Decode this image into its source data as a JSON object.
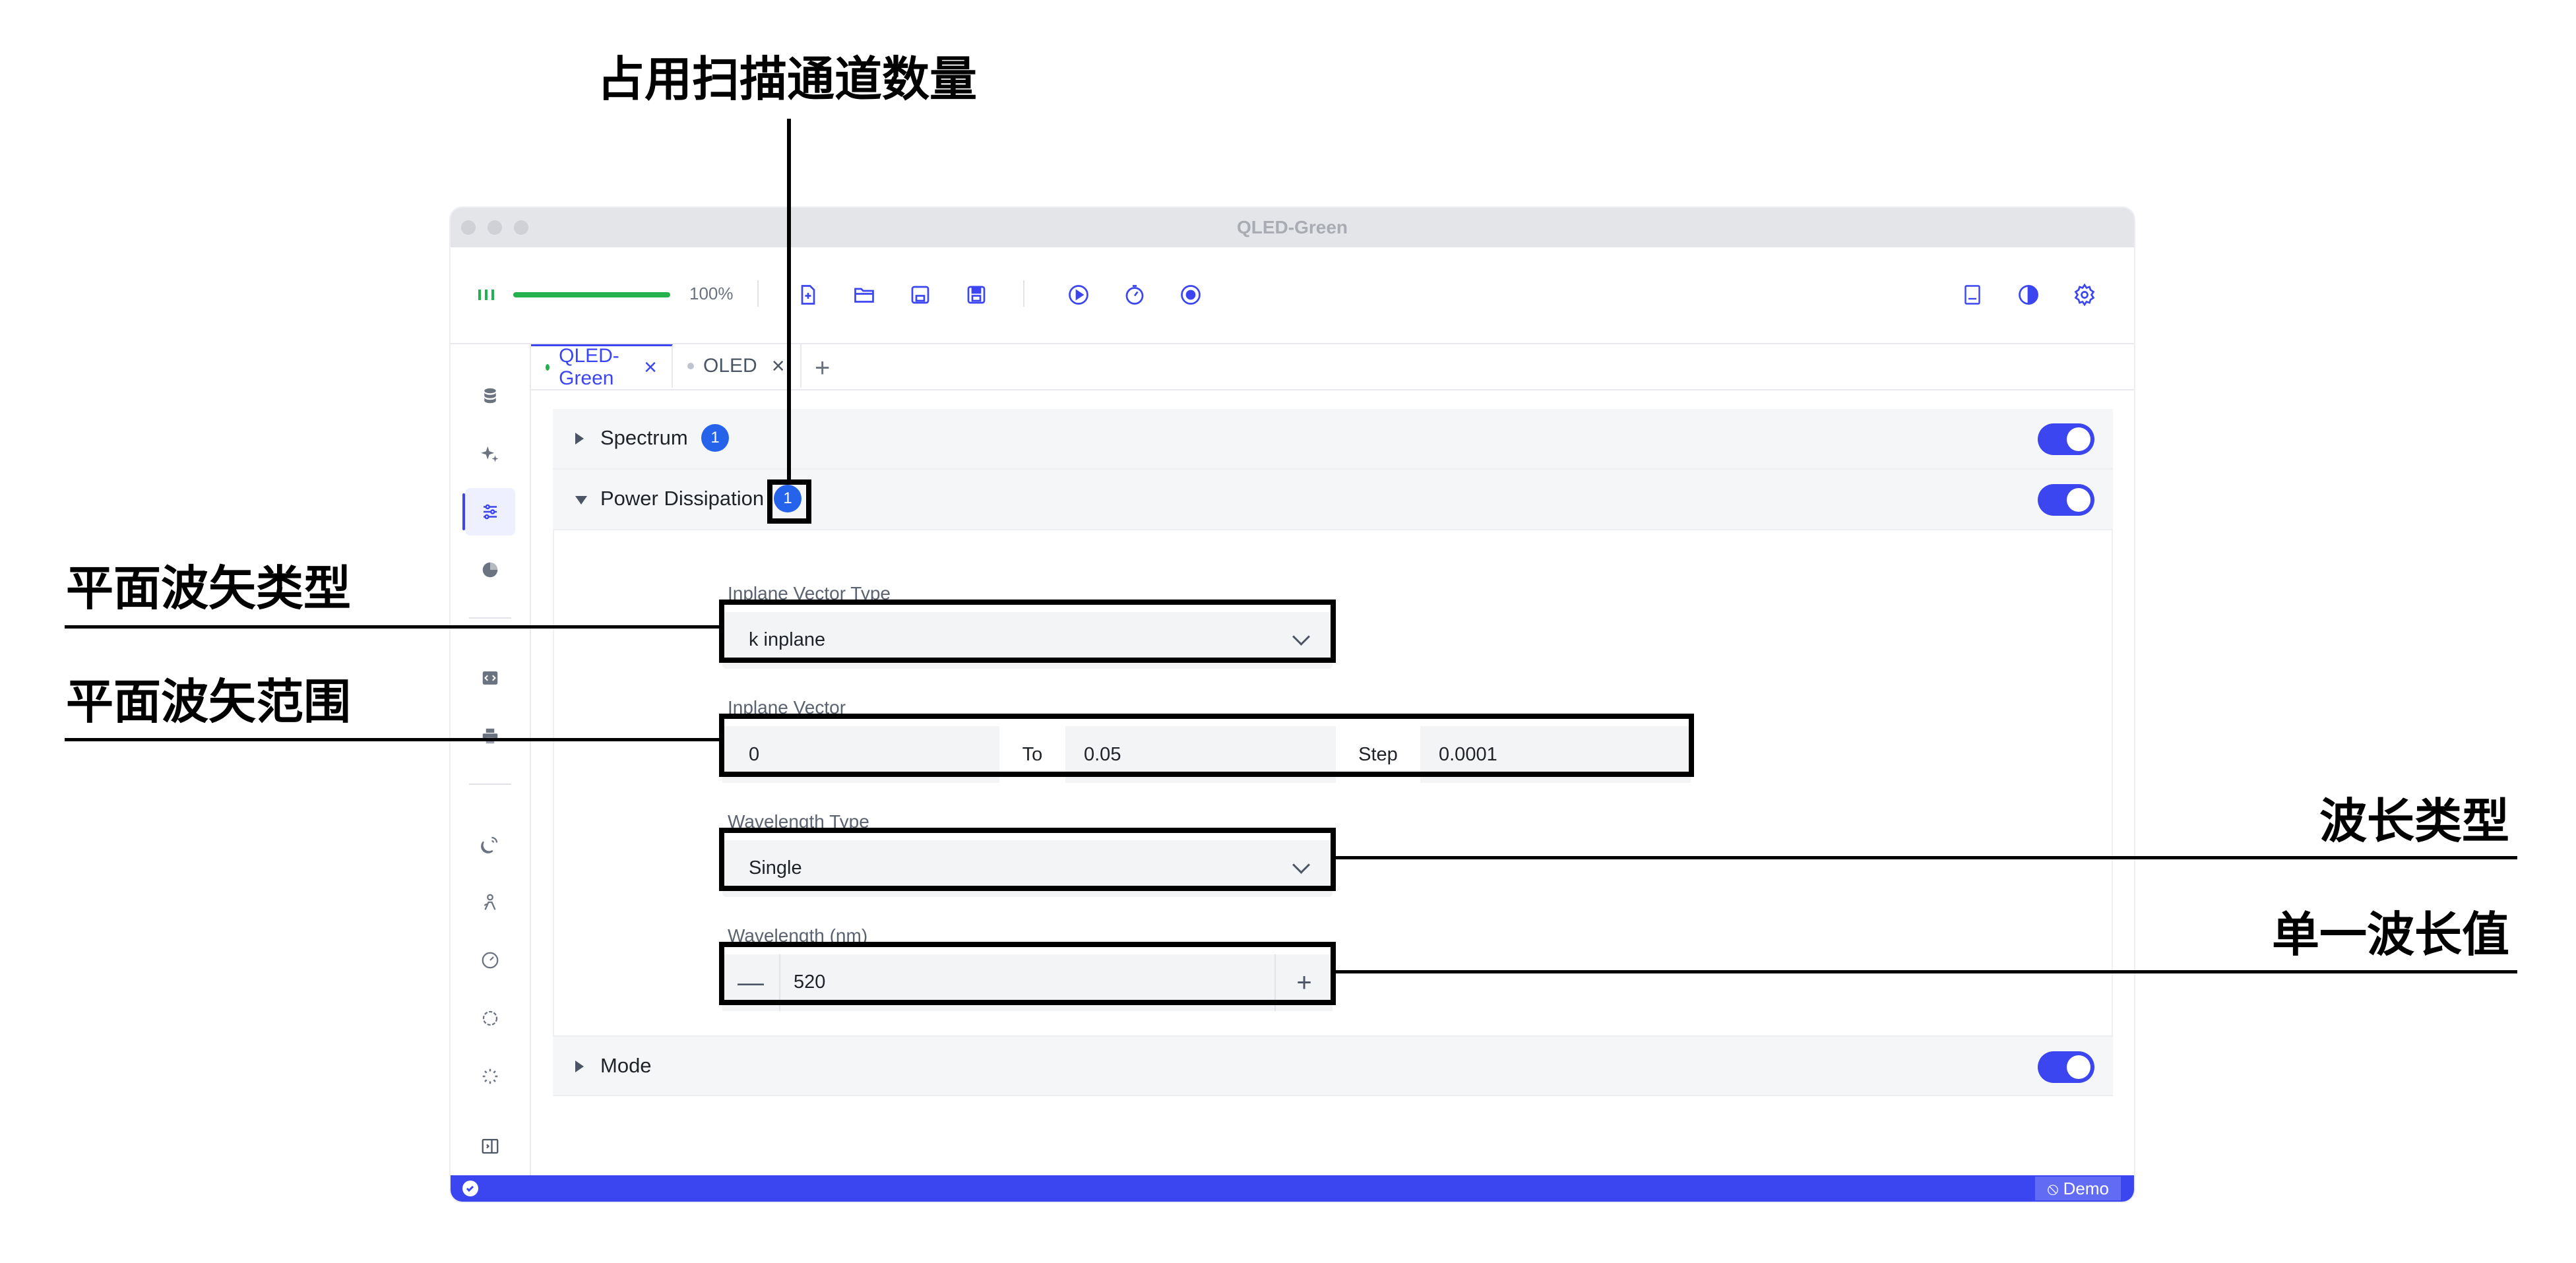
{
  "window": {
    "title": "QLED-Green"
  },
  "toolbar": {
    "progress_text": "100%",
    "progress_value": 1.0,
    "buttons": [
      "new-file-icon",
      "open-folder-icon",
      "save-icon",
      "save-all-icon",
      "run-icon",
      "timer-icon",
      "record-icon",
      "book-icon",
      "theme-icon",
      "gear-icon"
    ]
  },
  "tabs": [
    {
      "label": "QLED-Green",
      "active": true,
      "dot_color": "#22b14c"
    },
    {
      "label": "OLED",
      "active": false,
      "dot_color": "#c0c4cc"
    }
  ],
  "tab_add": "+",
  "panels": {
    "spectrum": {
      "title": "Spectrum",
      "badge": "1"
    },
    "power": {
      "title": "Power Dissipation",
      "badge": "1"
    },
    "mode": {
      "title": "Mode"
    }
  },
  "form": {
    "inplane_type_label": "Inplane Vector Type",
    "inplane_type_value": "k inplane",
    "inplane_vector_label": "Inplane Vector",
    "inplane_from": "0",
    "to_label": "To",
    "inplane_to": "0.05",
    "step_label": "Step",
    "inplane_step": "0.0001",
    "wavelength_type_label": "Wavelength Type",
    "wavelength_type_value": "Single",
    "wavelength_label": "Wavelength (nm)",
    "wavelength_value": "520",
    "minus": "—",
    "plus": "+"
  },
  "status": {
    "demo": "⦸ Demo"
  },
  "annotations": {
    "channels": "占用扫描通道数量",
    "inplane_type": "平面波矢类型",
    "inplane_range": "平面波矢范围",
    "wavelength_type": "波长类型",
    "wavelength_value": "单一波长值"
  },
  "colors": {
    "accent": "#3b46f1",
    "badge": "#2563eb",
    "success": "#22b14c"
  }
}
